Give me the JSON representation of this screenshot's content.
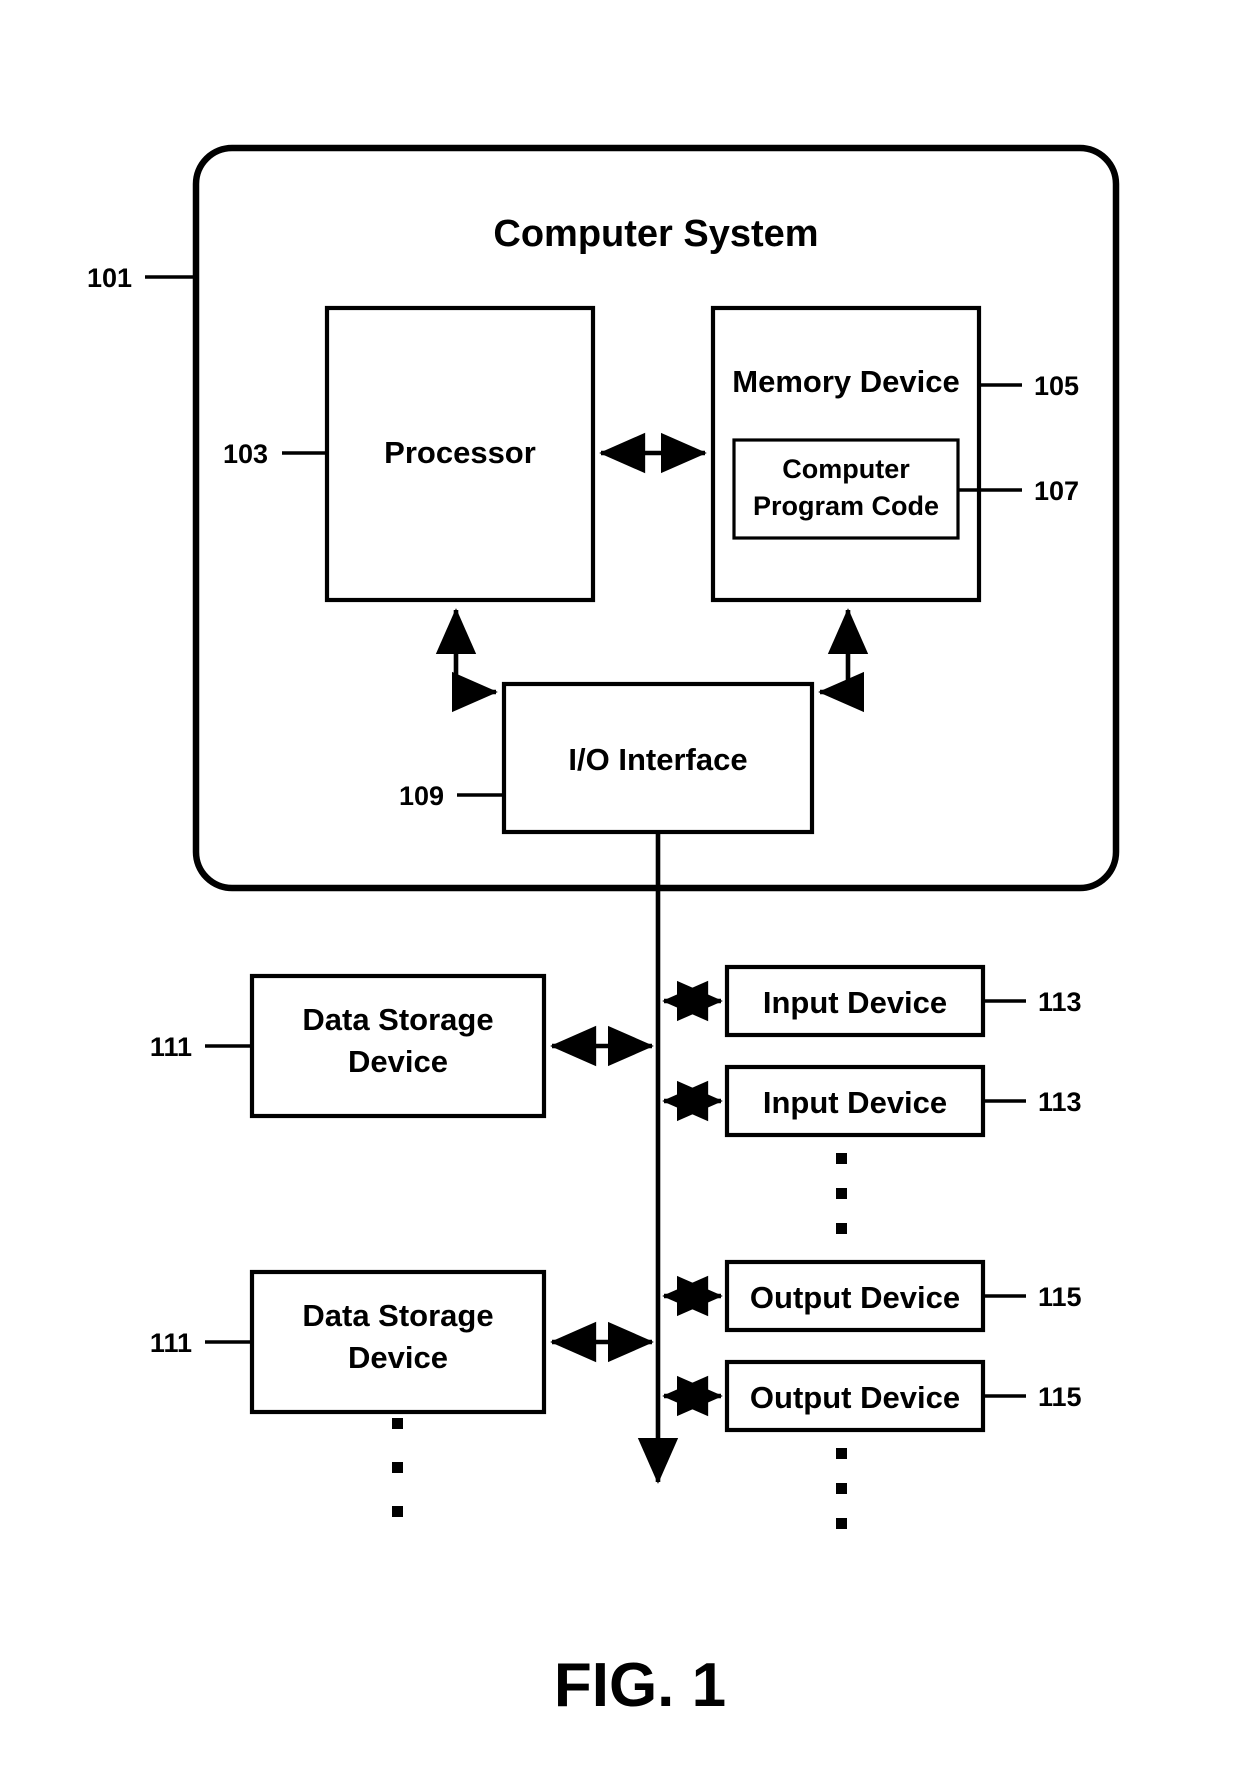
{
  "figure": {
    "caption": "FIG. 1",
    "title": "Computer System",
    "title_ref": "101"
  },
  "blocks": {
    "processor": {
      "label": "Processor",
      "ref": "103"
    },
    "memory_device": {
      "label": "Memory Device",
      "ref": "105"
    },
    "computer_program_code": {
      "label_line1": "Computer",
      "label_line2": "Program Code",
      "ref": "107"
    },
    "io_interface": {
      "label": "I/O Interface",
      "ref": "109"
    },
    "data_storage_1": {
      "label_line1": "Data Storage",
      "label_line2": "Device",
      "ref": "111"
    },
    "data_storage_2": {
      "label_line1": "Data Storage",
      "label_line2": "Device",
      "ref": "111"
    },
    "input_device_1": {
      "label": "Input Device",
      "ref": "113"
    },
    "input_device_2": {
      "label": "Input Device",
      "ref": "113"
    },
    "output_device_1": {
      "label": "Output Device",
      "ref": "115"
    },
    "output_device_2": {
      "label": "Output Device",
      "ref": "115"
    }
  },
  "ellipses": {
    "input_devices": "vertical-ellipsis",
    "output_devices": "vertical-ellipsis",
    "data_storage_devices": "vertical-ellipsis"
  },
  "connections": {
    "processor_memory": "bidirectional-arrow",
    "processor_io": "bidirectional-elbow-arrow",
    "memory_io": "bidirectional-elbow-arrow",
    "io_bus": "downward-arrow",
    "bus_to_data_storage_1": "bidirectional-arrow",
    "bus_to_data_storage_2": "bidirectional-arrow",
    "bus_to_input_1": "bidirectional-arrow",
    "bus_to_input_2": "bidirectional-arrow",
    "bus_to_output_1": "bidirectional-arrow",
    "bus_to_output_2": "bidirectional-arrow"
  },
  "colors": {
    "stroke": "#000000",
    "background": "#ffffff",
    "text": "#000000"
  }
}
